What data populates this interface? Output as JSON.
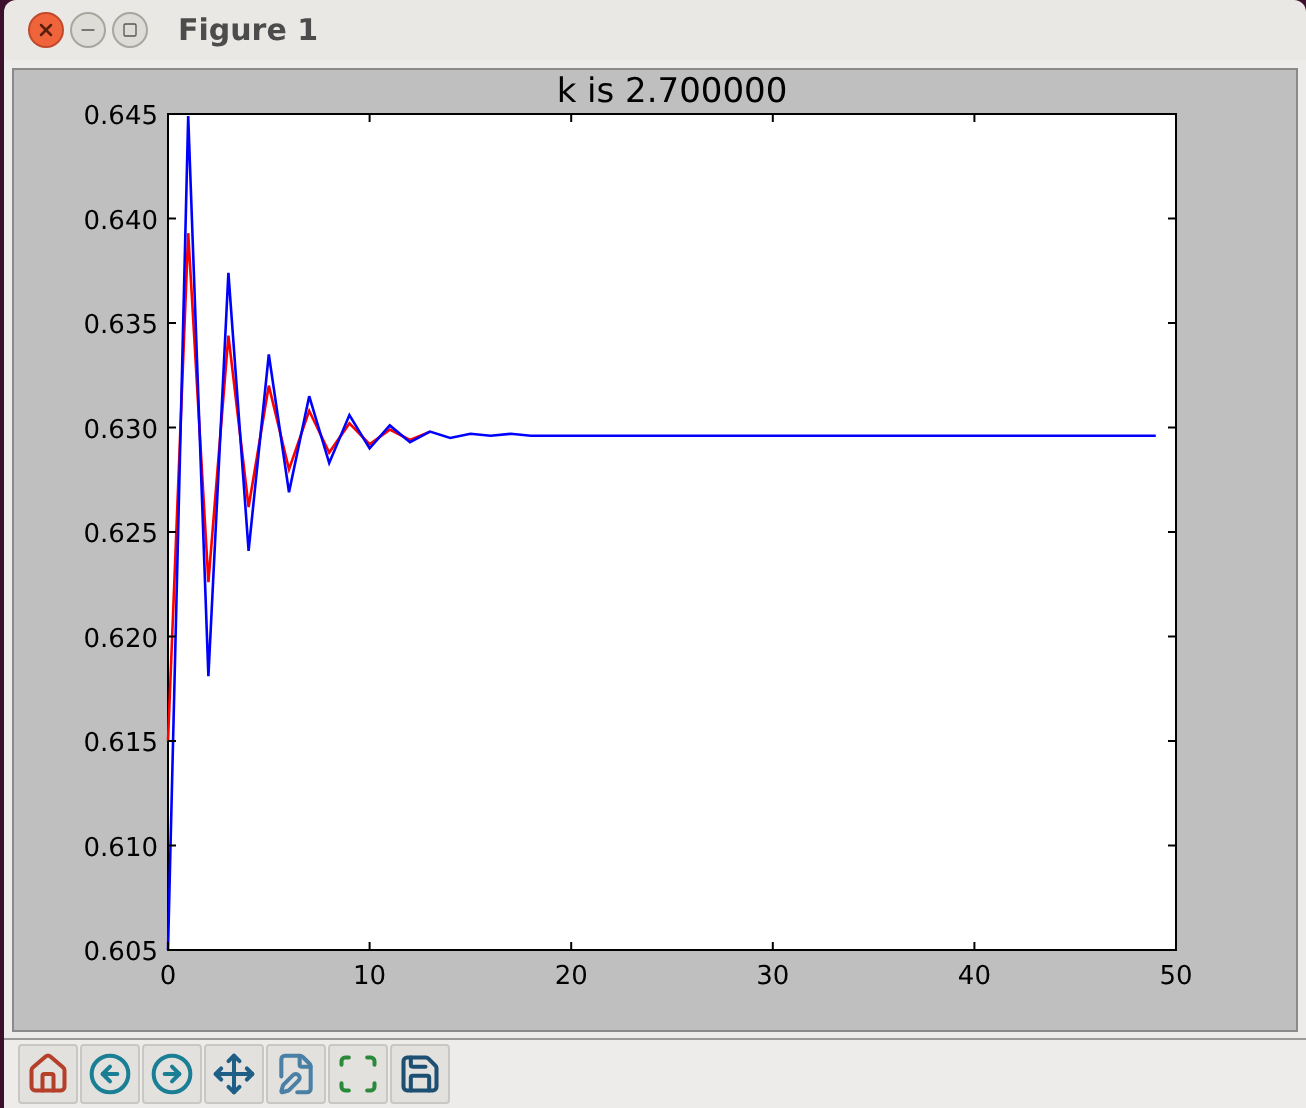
{
  "window": {
    "title": "Figure 1"
  },
  "figure": {
    "chart_data": {
      "type": "line",
      "title": "k is 2.700000",
      "x": [
        0,
        1,
        2,
        3,
        4,
        5,
        6,
        7,
        8,
        9,
        10,
        11,
        12,
        13,
        14,
        15,
        16,
        17,
        18,
        19,
        20,
        21,
        22,
        23,
        24,
        25,
        26,
        27,
        28,
        29,
        30,
        31,
        32,
        33,
        34,
        35,
        36,
        37,
        38,
        39,
        40,
        41,
        42,
        43,
        44,
        45,
        46,
        47,
        48,
        49
      ],
      "series": [
        {
          "color": "#ff0000",
          "values": [
            0.615,
            0.6393,
            0.6226,
            0.6344,
            0.6262,
            0.632,
            0.628,
            0.6308,
            0.6288,
            0.6302,
            0.6292,
            0.6299,
            0.6294,
            0.6298,
            null,
            null,
            null,
            null,
            null,
            null,
            null,
            null,
            null,
            null,
            null,
            null,
            null,
            null,
            null,
            null,
            null,
            null,
            null,
            null,
            null,
            null,
            null,
            null,
            null,
            null,
            null,
            null,
            null,
            null,
            null,
            null,
            null,
            null,
            null,
            null
          ]
        },
        {
          "color": "#0000ff",
          "values": [
            0.605,
            0.6449,
            0.6181,
            0.6374,
            0.6241,
            0.6335,
            0.6269,
            0.6315,
            0.6283,
            0.6306,
            0.629,
            0.6301,
            0.6293,
            0.6298,
            0.6295,
            0.6297,
            0.6296,
            0.6297,
            0.6296,
            0.6296,
            0.6296,
            0.6296,
            0.6296,
            0.6296,
            0.6296,
            0.6296,
            0.6296,
            0.6296,
            0.6296,
            0.6296,
            0.6296,
            0.6296,
            0.6296,
            0.6296,
            0.6296,
            0.6296,
            0.6296,
            0.6296,
            0.6296,
            0.6296,
            0.6296,
            0.6296,
            0.6296,
            0.6296,
            0.6296,
            0.6296,
            0.6296,
            0.6296,
            0.6296,
            0.6296
          ]
        }
      ],
      "xlim": [
        0,
        50
      ],
      "ylim": [
        0.605,
        0.645
      ],
      "xticks": [
        {
          "value": 0,
          "label": "0"
        },
        {
          "value": 10,
          "label": "10"
        },
        {
          "value": 20,
          "label": "20"
        },
        {
          "value": 30,
          "label": "30"
        },
        {
          "value": 40,
          "label": "40"
        },
        {
          "value": 50,
          "label": "50"
        }
      ],
      "yticks": [
        {
          "value": 0.605,
          "label": "0.605"
        },
        {
          "value": 0.61,
          "label": "0.610"
        },
        {
          "value": 0.615,
          "label": "0.615"
        },
        {
          "value": 0.62,
          "label": "0.620"
        },
        {
          "value": 0.625,
          "label": "0.625"
        },
        {
          "value": 0.63,
          "label": "0.630"
        },
        {
          "value": 0.635,
          "label": "0.635"
        },
        {
          "value": 0.64,
          "label": "0.640"
        },
        {
          "value": 0.645,
          "label": "0.645"
        }
      ]
    }
  }
}
